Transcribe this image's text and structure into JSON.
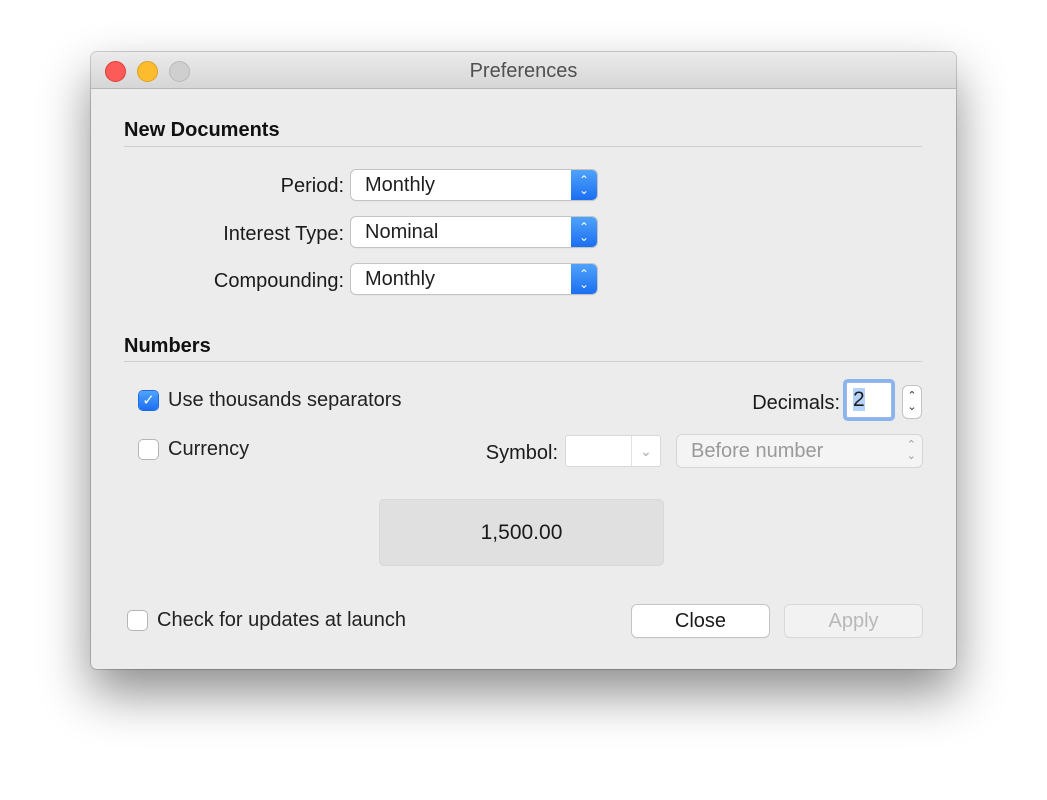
{
  "window": {
    "title": "Preferences",
    "traffic_lights": [
      "close",
      "minimize",
      "zoom"
    ]
  },
  "new_documents": {
    "heading": "New Documents",
    "fields": [
      {
        "label": "Period:",
        "value": "Monthly"
      },
      {
        "label": "Interest Type:",
        "value": "Nominal"
      },
      {
        "label": "Compounding:",
        "value": "Monthly"
      }
    ]
  },
  "numbers": {
    "heading": "Numbers",
    "thousands_separators": {
      "label": "Use thousands separators",
      "checked": true
    },
    "currency": {
      "label": "Currency",
      "checked": false
    },
    "decimals": {
      "label": "Decimals:",
      "value": "2"
    },
    "symbol": {
      "label": "Symbol:",
      "value": ""
    },
    "position": {
      "value": "Before number",
      "enabled": false
    },
    "preview": "1,500.00"
  },
  "footer": {
    "check_updates": {
      "label": "Check for updates at launch",
      "checked": false
    },
    "close_label": "Close",
    "apply_label": "Apply"
  },
  "icons": {
    "popup_arrows": "⌃⌄",
    "checkmark": "✓",
    "chevron_down": "⌄"
  },
  "colors": {
    "accent": "#1b6ff1",
    "close_light": "#fc5b57",
    "minimize_light": "#fdbc2e",
    "zoom_light": "#cfcfcf"
  }
}
